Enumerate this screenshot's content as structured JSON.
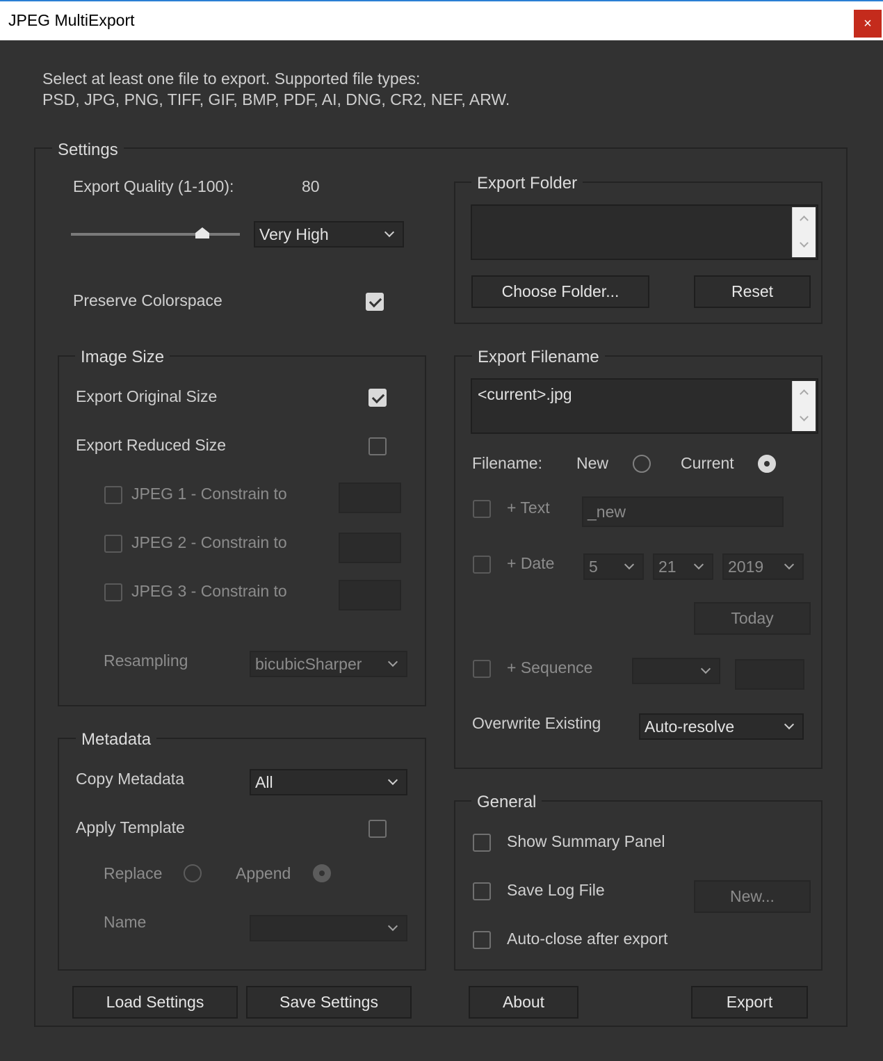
{
  "window": {
    "title": "JPEG MultiExport",
    "close_glyph": "×"
  },
  "intro": {
    "line1": "Select at least one file to export. Supported file types:",
    "line2": "PSD, JPG, PNG, TIFF, GIF, BMP, PDF, AI, DNG, CR2, NEF, ARW."
  },
  "settings": {
    "title": "Settings",
    "quality_label": "Export Quality (1-100):",
    "quality_value": "80",
    "quality_slider_fraction": 0.8,
    "quality_preset": "Very High",
    "preserve_colorspace_label": "Preserve Colorspace",
    "preserve_colorspace_checked": true
  },
  "image_size": {
    "title": "Image Size",
    "export_original_label": "Export Original Size",
    "export_original_checked": true,
    "export_reduced_label": "Export Reduced Size",
    "export_reduced_checked": false,
    "jpeg1_label": "JPEG 1 - Constrain to",
    "jpeg2_label": "JPEG 2 - Constrain to",
    "jpeg3_label": "JPEG 3 - Constrain to",
    "resampling_label": "Resampling",
    "resampling_value": "bicubicSharper"
  },
  "metadata": {
    "title": "Metadata",
    "copy_label": "Copy Metadata",
    "copy_value": "All",
    "apply_template_label": "Apply Template",
    "replace_label": "Replace",
    "append_label": "Append",
    "name_label": "Name",
    "name_value": ""
  },
  "export_folder": {
    "title": "Export Folder",
    "path": "",
    "choose_label": "Choose Folder...",
    "reset_label": "Reset"
  },
  "export_filename": {
    "title": "Export Filename",
    "value": "<current>.jpg",
    "filename_label": "Filename:",
    "new_label": "New",
    "current_label": "Current",
    "text_label": "+ Text",
    "text_value": "_new",
    "date_label": "+ Date",
    "date_month": "5",
    "date_day": "21",
    "date_year": "2019",
    "today_label": "Today",
    "sequence_label": "+ Sequence",
    "overwrite_label": "Overwrite Existing",
    "overwrite_value": "Auto-resolve"
  },
  "general": {
    "title": "General",
    "summary_label": "Show Summary Panel",
    "log_label": "Save Log File",
    "log_new_label": "New...",
    "autoclose_label": "Auto-close after export"
  },
  "footer": {
    "load_label": "Load Settings",
    "save_label": "Save Settings",
    "about_label": "About",
    "export_label": "Export"
  }
}
